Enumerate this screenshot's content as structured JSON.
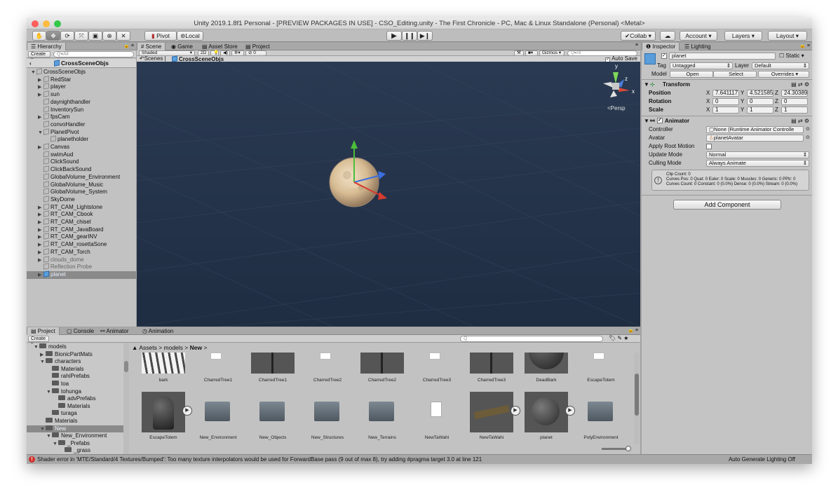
{
  "window": {
    "title": "Unity 2019.1.8f1 Personal - [PREVIEW PACKAGES IN USE] - CSO_Editing.unity - The First Chronicle - PC, Mac & Linux Standalone (Personal) <Metal>"
  },
  "toolbar": {
    "tools": [
      "hand-tool",
      "move-tool",
      "rotate-tool",
      "scale-tool",
      "rect-tool",
      "transform-tool",
      "custom-tool"
    ],
    "pivot_label": "Pivot",
    "local_label": "Local",
    "collab_label": "Collab",
    "account_label": "Account",
    "layers_label": "Layers",
    "layout_label": "Layout"
  },
  "hierarchy": {
    "tab_label": "Hierarchy",
    "create_label": "Create",
    "search_placeholder": "Q▾All",
    "scene_header": "CrossSceneObjs",
    "items": [
      {
        "label": "CrossSceneObjs",
        "depth": 0,
        "expanded": true,
        "arrow": true
      },
      {
        "label": "RedStar",
        "depth": 1,
        "arrow": true
      },
      {
        "label": "player",
        "depth": 1,
        "arrow": true
      },
      {
        "label": "sun",
        "depth": 1,
        "arrow": true
      },
      {
        "label": "daynighthandler",
        "depth": 1,
        "arrow": false
      },
      {
        "label": "InventorySun",
        "depth": 1,
        "arrow": false
      },
      {
        "label": "fpsCam",
        "depth": 1,
        "arrow": true
      },
      {
        "label": "convoHandler",
        "depth": 1,
        "arrow": false
      },
      {
        "label": "PlanetPivot",
        "depth": 1,
        "arrow": true,
        "expanded": true
      },
      {
        "label": "planetholder",
        "depth": 2,
        "arrow": false
      },
      {
        "label": "Canvas",
        "depth": 1,
        "arrow": true
      },
      {
        "label": "swimAud",
        "depth": 1,
        "arrow": false
      },
      {
        "label": "ClickSound",
        "depth": 1,
        "arrow": false
      },
      {
        "label": "ClickBackSound",
        "depth": 1,
        "arrow": false
      },
      {
        "label": "GlobalVolume_Environment",
        "depth": 1,
        "arrow": false
      },
      {
        "label": "GlobalVolume_Music",
        "depth": 1,
        "arrow": false
      },
      {
        "label": "GlobalVolume_System",
        "depth": 1,
        "arrow": false
      },
      {
        "label": "SkyDome",
        "depth": 1,
        "arrow": false
      },
      {
        "label": "RT_CAM_Lightstone",
        "depth": 1,
        "arrow": true
      },
      {
        "label": "RT_CAM_Cbook",
        "depth": 1,
        "arrow": true
      },
      {
        "label": "RT_CAM_chisel",
        "depth": 1,
        "arrow": true
      },
      {
        "label": "RT_CAM_JavaBoard",
        "depth": 1,
        "arrow": true
      },
      {
        "label": "RT_CAM_gearINV",
        "depth": 1,
        "arrow": true
      },
      {
        "label": "RT_CAM_rosettaSone",
        "depth": 1,
        "arrow": true
      },
      {
        "label": "RT_CAM_Torch",
        "depth": 1,
        "arrow": true
      },
      {
        "label": "clouds_dome",
        "depth": 1,
        "arrow": true,
        "dim": true
      },
      {
        "label": "Reflection Probe",
        "depth": 1,
        "arrow": false,
        "dim": true
      },
      {
        "label": "planet",
        "depth": 1,
        "arrow": true,
        "selected": true
      }
    ]
  },
  "scene_view": {
    "tabs": [
      "Scene",
      "Game",
      "Asset Store",
      "Project"
    ],
    "shading_mode": "Shaded",
    "two_d_label": "2D",
    "gizmos_label": "Gizmos",
    "search_placeholder": "Q▾All",
    "fx_count": "0",
    "breadcrumb_root": "Scenes",
    "breadcrumb_scene": "CrossSceneObjs",
    "auto_save_label": "Auto Save",
    "persp_label": "<Persp",
    "gizmo_axis_y": "y",
    "gizmo_axis_x": "x",
    "gizmo_axis_z": "z"
  },
  "inspector": {
    "tabs": [
      "Inspector",
      "Lighting"
    ],
    "object_name": "planet",
    "static_label": "Static",
    "tag_label": "Tag",
    "tag_value": "Untagged",
    "layer_label": "Layer",
    "layer_value": "Default",
    "model_label": "Model",
    "model_open": "Open",
    "model_select": "Select",
    "model_overrides": "Overrides",
    "transform": {
      "title": "Transform",
      "position_label": "Position",
      "rotation_label": "Rotation",
      "scale_label": "Scale",
      "position": {
        "x": "7.641117",
        "y": "4.521585",
        "z": "24.30389"
      },
      "rotation": {
        "x": "0",
        "y": "0",
        "z": "0"
      },
      "scale": {
        "x": "1",
        "y": "1",
        "z": "1"
      }
    },
    "animator": {
      "title": "Animator",
      "controller_label": "Controller",
      "controller_value": "None (Runtime Animator Controlle",
      "avatar_label": "Avatar",
      "avatar_value": "planetAvatar",
      "apply_root_motion_label": "Apply Root Motion",
      "update_mode_label": "Update Mode",
      "update_mode_value": "Normal",
      "culling_mode_label": "Culling Mode",
      "culling_mode_value": "Always Animate",
      "info_line1": "Clip Count: 0",
      "info_line2": "Curves Pos: 0 Quat: 0 Euler: 0 Scale: 0 Muscles: 0 Generic: 0 PPtr: 0",
      "info_line3": "Curves Count: 0 Constant: 0 (0.0%) Dense: 0 (0.0%) Stream: 0 (0.0%)"
    },
    "add_component_label": "Add Component"
  },
  "project": {
    "tabs": [
      "Project",
      "Console",
      "Animator",
      "Animation"
    ],
    "create_label": "Create",
    "breadcrumb": [
      "Assets",
      "models",
      "New"
    ],
    "tree": [
      {
        "label": "models",
        "depth": 0,
        "expanded": true
      },
      {
        "label": "BionicPartMats",
        "depth": 1,
        "arrow": true
      },
      {
        "label": "characters",
        "depth": 1,
        "expanded": true
      },
      {
        "label": "Materials",
        "depth": 2
      },
      {
        "label": "rahiPrefabs",
        "depth": 2
      },
      {
        "label": "toa",
        "depth": 2
      },
      {
        "label": "tohunga",
        "depth": 2,
        "expanded": true
      },
      {
        "label": "advPrefabs",
        "depth": 3
      },
      {
        "label": "Materials",
        "depth": 3
      },
      {
        "label": "turaga",
        "depth": 2
      },
      {
        "label": "Materials",
        "depth": 1
      },
      {
        "label": "New",
        "depth": 1,
        "expanded": true,
        "selected": true
      },
      {
        "label": "New_Environment",
        "depth": 2,
        "expanded": true
      },
      {
        "label": "_Prefabs",
        "depth": 3,
        "expanded": true
      },
      {
        "label": "_grass",
        "depth": 4
      }
    ],
    "assets_row1": [
      "bark",
      "CharredTree1",
      "CharredTree1",
      "CharredTree2",
      "CharredTree2",
      "CharredTree3",
      "CharredTree3",
      "DeadBark",
      "EscapeTotem"
    ],
    "assets_row2": [
      "EscapeTotem",
      "New_Environment",
      "New_Objects",
      "New_Structures",
      "New_Terrains",
      "NewTaWahi",
      "NewTaWahi",
      "planet",
      "PolyEnvironment"
    ]
  },
  "status": {
    "error_message": "Shader error in 'MTE/Standard/4 Textures/Bumped': Too many texture interpolators would be used for ForwardBase pass (9 out of max 8), try adding #pragma target 3.0 at line 121",
    "lighting_label": "Auto Generate Lighting Off"
  },
  "colors": {
    "scene_bg": "#25344a",
    "selection": "#3b82d6",
    "error": "#d0312d"
  }
}
